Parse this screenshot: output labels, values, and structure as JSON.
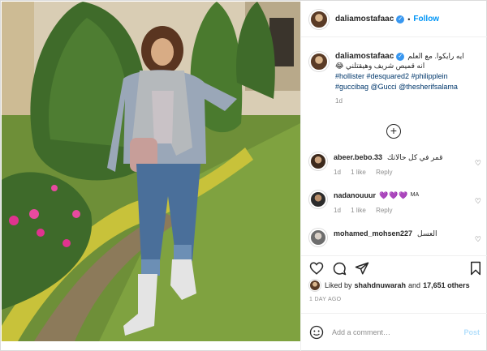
{
  "header": {
    "username": "daliamostafaac",
    "separator": "•",
    "follow_label": "Follow"
  },
  "caption": {
    "username": "daliamostafaac",
    "text_ar_1": "ايه رايكوا. مع العلم",
    "text_ar_2": "انه قميص شريف وهيقتلني 😂",
    "hashtags_1": "#hollister #desquared2 #philipplein",
    "hashtags_2": "#guccibag @Gucci @thesherifsalama",
    "age": "1d"
  },
  "load_more": "+",
  "comments": [
    {
      "username": "abeer.bebo.33",
      "text": "قمر في كل حالاتك",
      "age": "1d",
      "likes": "1 like",
      "reply": "Reply"
    },
    {
      "username": "nadanouuur",
      "text": "💜💜💜",
      "suffix": "MA",
      "age": "1d",
      "likes": "1 like",
      "reply": "Reply"
    },
    {
      "username": "mohamed_mohsen227",
      "text": "العسل"
    }
  ],
  "likes": {
    "prefix": "Liked by",
    "user": "shahdnuwarah",
    "and": "and",
    "count": "17,651 others"
  },
  "date": "1 DAY AGO",
  "add_comment": {
    "placeholder": "Add a comment…",
    "post_label": "Post"
  },
  "colors": {
    "accent": "#0095f6",
    "verified": "#3897f0",
    "post_disabled": "#b2dffc"
  },
  "icons": [
    "verified-badge-icon",
    "plus-circle-icon",
    "heart-icon",
    "comment-icon",
    "share-icon",
    "bookmark-icon",
    "emoji-icon"
  ]
}
